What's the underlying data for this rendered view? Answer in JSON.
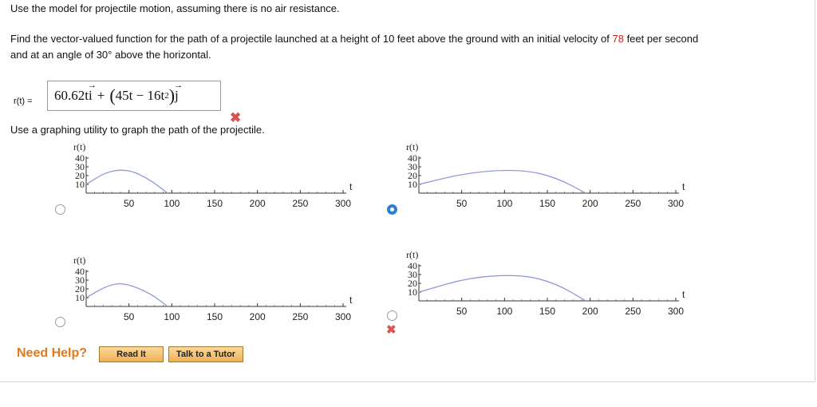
{
  "problem": {
    "intro": "Use the model for projectile motion, assuming there is no air resistance.",
    "line1_pre": "Find the vector-valued function for the path of a projectile launched at a height of 10 feet above the ground with an initial velocity of ",
    "velocity": "78",
    "line1_post": " feet per second",
    "line2": "and at an angle of 30° above the horizontal."
  },
  "answer": {
    "label": "r(t) =",
    "term1": "60.62t",
    "unit_i": "i",
    "plus": "+",
    "term2a": "45t − 16t",
    "term2_exp": "2",
    "unit_j": "j",
    "status": "incorrect"
  },
  "graph_prompt": "Use a graphing utility to graph the path of the projectile.",
  "chart_data": [
    {
      "type": "line",
      "ylabel": "r(t)",
      "xlabel": "t",
      "xticks": [
        50,
        100,
        150,
        200,
        250,
        300
      ],
      "yticks": [
        10,
        20,
        30,
        40
      ],
      "xlim": [
        0,
        300
      ],
      "ylim": [
        0,
        40
      ],
      "series": [
        {
          "x": [
            0,
            25,
            50,
            75,
            95
          ],
          "y": [
            10,
            25,
            27,
            15,
            0
          ]
        }
      ],
      "selected": false
    },
    {
      "type": "line",
      "ylabel": "r(t)",
      "xlabel": "t",
      "xticks": [
        50,
        100,
        150,
        200,
        250,
        300
      ],
      "yticks": [
        10,
        20,
        30,
        40
      ],
      "xlim": [
        0,
        300
      ],
      "ylim": [
        0,
        40
      ],
      "series": [
        {
          "x": [
            0,
            60,
            120,
            160,
            195
          ],
          "y": [
            10,
            24,
            27,
            18,
            0
          ]
        }
      ],
      "selected": true
    },
    {
      "type": "line",
      "ylabel": "r(t)",
      "xlabel": "t",
      "xticks": [
        50,
        100,
        150,
        200,
        250,
        300
      ],
      "yticks": [
        10,
        20,
        30,
        40
      ],
      "xlim": [
        0,
        300
      ],
      "ylim": [
        0,
        40
      ],
      "series": [
        {
          "x": [
            0,
            25,
            45,
            75,
            95
          ],
          "y": [
            10,
            24,
            27,
            15,
            0
          ]
        }
      ],
      "selected": false
    },
    {
      "type": "line",
      "ylabel": "r(t)",
      "xlabel": "t",
      "xticks": [
        50,
        100,
        150,
        200,
        250,
        300
      ],
      "yticks": [
        10,
        20,
        30,
        40
      ],
      "xlim": [
        0,
        300
      ],
      "ylim": [
        0,
        40
      ],
      "series": [
        {
          "x": [
            0,
            60,
            120,
            160,
            195
          ],
          "y": [
            10,
            27,
            30,
            20,
            0
          ]
        }
      ],
      "selected": false
    }
  ],
  "help": {
    "label": "Need Help?",
    "read_it": "Read It",
    "tutor": "Talk to a Tutor"
  },
  "colors": {
    "curve": "#8a93d8",
    "accent_red": "#cc2222",
    "radio_selected": "#2d7fd8",
    "help_orange": "#e07a1e"
  },
  "icons": {
    "incorrect": "x-mark-icon"
  }
}
